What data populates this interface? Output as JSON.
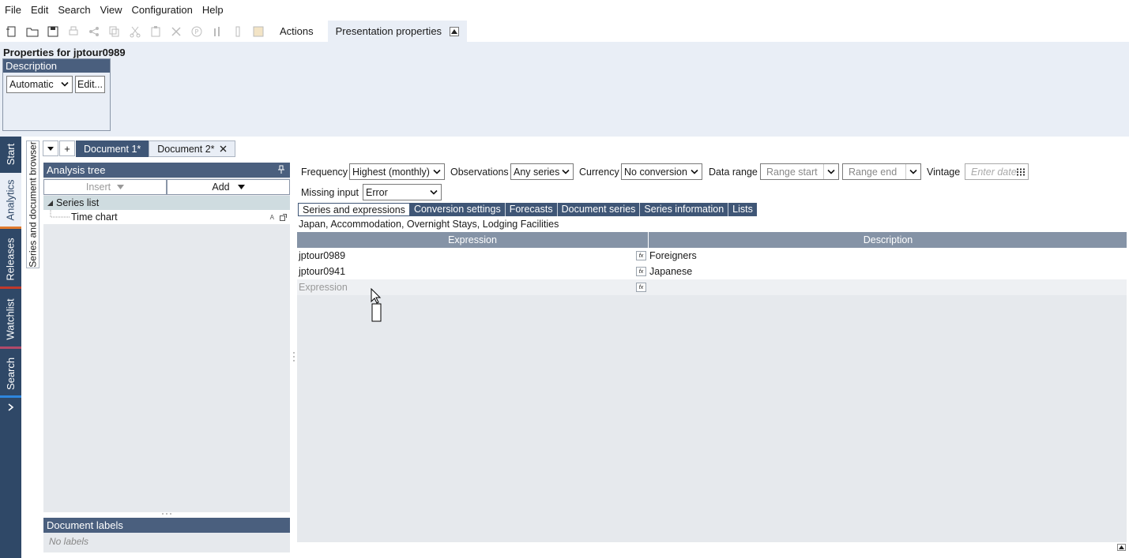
{
  "menu": [
    "File",
    "Edit",
    "Search",
    "View",
    "Configuration",
    "Help"
  ],
  "toolbar": {
    "actions_label": "Actions",
    "presentation_tab": "Presentation properties"
  },
  "properties": {
    "title": "Properties for jptour0989",
    "description_header": "Description",
    "description_select": "Automatic",
    "edit_button": "Edit..."
  },
  "leftnav": [
    "Start",
    "Analytics",
    "Releases",
    "Watchlist",
    "Search"
  ],
  "series_browser_tab": "Series and document browser",
  "doc_tabs": [
    "Document 1*",
    "Document 2*"
  ],
  "analysis_tree": {
    "title": "Analysis tree",
    "insert_label": "Insert",
    "add_label": "Add",
    "series_list_label": "Series list",
    "time_chart_label": "Time chart"
  },
  "document_labels": {
    "title": "Document labels",
    "empty_text": "No labels"
  },
  "settings": {
    "frequency_label": "Frequency",
    "frequency_value": "Highest (monthly)",
    "observations_label": "Observations",
    "observations_value": "Any series",
    "currency_label": "Currency",
    "currency_value": "No conversion",
    "data_range_label": "Data range",
    "range_start_placeholder": "Range start",
    "range_end_placeholder": "Range end",
    "vintage_label": "Vintage",
    "vintage_placeholder": "Enter date",
    "missing_input_label": "Missing input",
    "missing_input_value": "Error"
  },
  "sub_tabs": [
    "Series and expressions",
    "Conversion settings",
    "Forecasts",
    "Document series",
    "Series information",
    "Lists"
  ],
  "series_heading": "Japan, Accommodation, Overnight Stays, Lodging Facilities",
  "grid": {
    "col_expression": "Expression",
    "col_description": "Description",
    "rows": [
      {
        "expression": "jptour0989",
        "description": "Foreigners"
      },
      {
        "expression": "jptour0941",
        "description": "Japanese"
      }
    ],
    "new_row_placeholder": "Expression",
    "fx_label": "fx"
  },
  "colors": {
    "nav_dark": "#2f4867",
    "header_blue": "#4a5f7e",
    "panel_light": "#e9eef6",
    "accent_orange": "#e07a2e",
    "accent_red": "#c0392b",
    "accent_pink": "#b24a6a",
    "accent_blue": "#2e86de"
  }
}
